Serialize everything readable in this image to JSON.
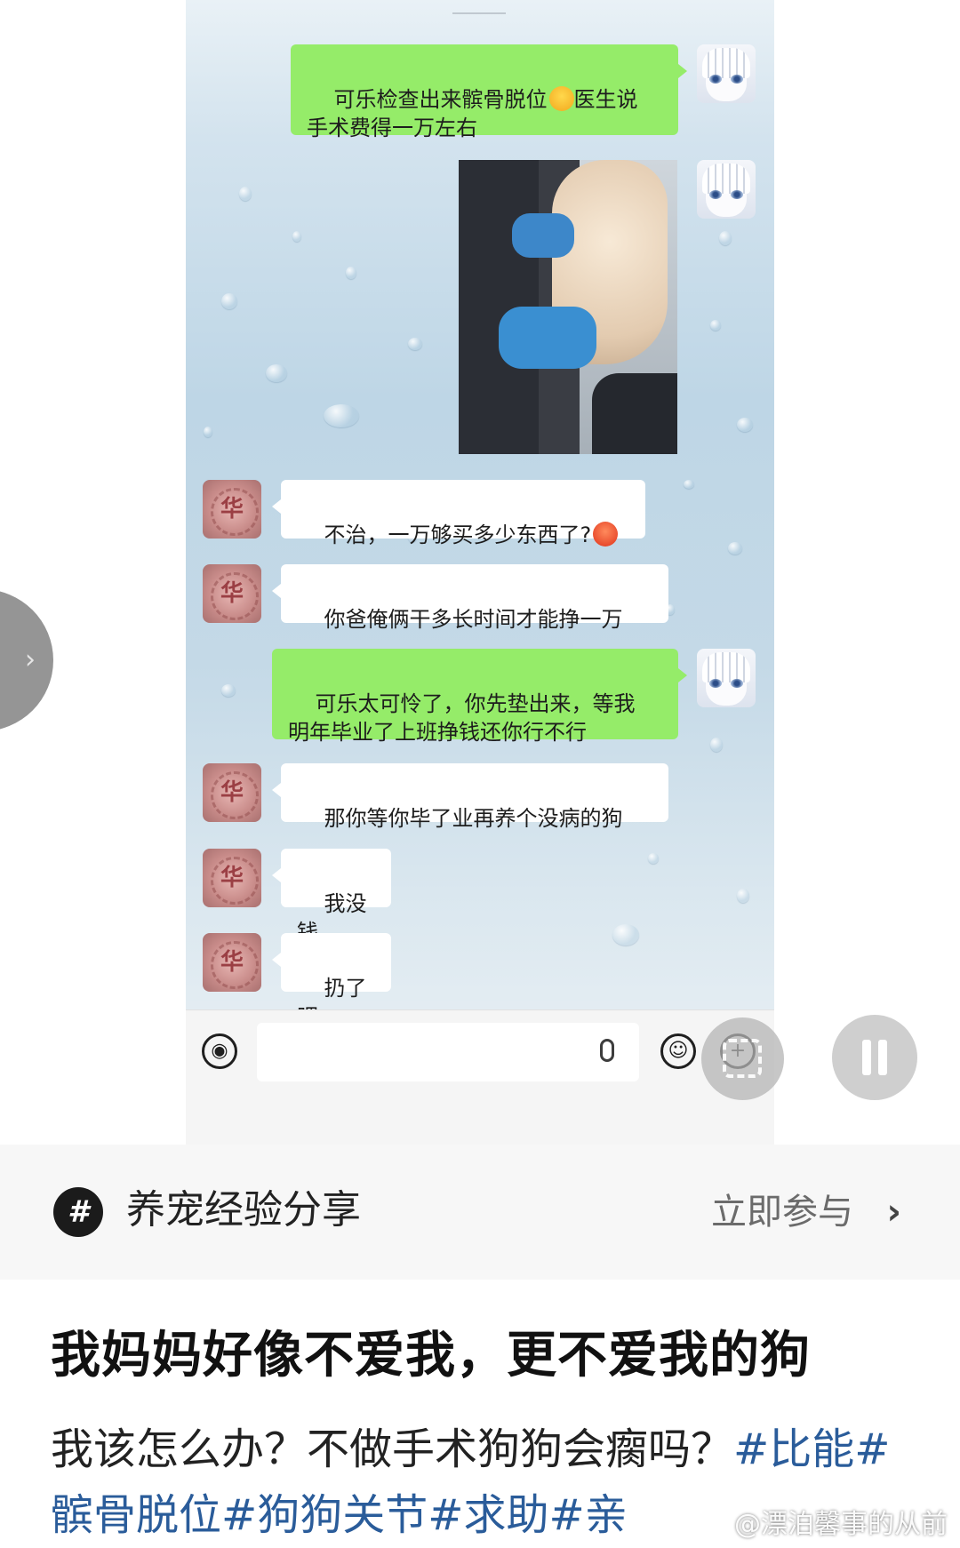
{
  "chat": {
    "messages": [
      {
        "sender": "me",
        "text": "可乐检查出来髌骨脱位",
        "text_after_emoji": "医生说\n手术费得一万左右",
        "emoji": "crying-face"
      },
      {
        "sender": "me",
        "type": "image",
        "description": "dog-photo"
      },
      {
        "sender": "mom",
        "text": "不治，一万够买多少东西了?",
        "emoji": "angry-face"
      },
      {
        "sender": "mom",
        "text": "你爸俺俩干多长时间才能挣一万"
      },
      {
        "sender": "me",
        "text": "可乐太可怜了，你先垫出来，等我\n明年毕业了上班挣钱还你行不行"
      },
      {
        "sender": "mom",
        "text": "那你等你毕了业再养个没病的狗"
      },
      {
        "sender": "mom",
        "text": "我没钱"
      },
      {
        "sender": "mom",
        "text": "扔了吧"
      }
    ],
    "mom_avatar_glyph": "华",
    "colors": {
      "my_bubble": "#95ec69",
      "their_bubble": "#ffffff"
    }
  },
  "topic": {
    "title": "养宠经验分享",
    "join_label": "立即参与",
    "icon": "hashtag-icon"
  },
  "post": {
    "title": "我妈妈好像不爱我，更不爱我的狗",
    "body_text": "我该怎么办？不做手术狗狗会瘸吗？",
    "hashtags": [
      "#比能",
      "#髌骨脱位",
      "#狗狗关节",
      "#求助",
      "#亲"
    ],
    "hashtag_color": "#2a5c9a"
  },
  "watermark": "@漂泊馨事的从前"
}
